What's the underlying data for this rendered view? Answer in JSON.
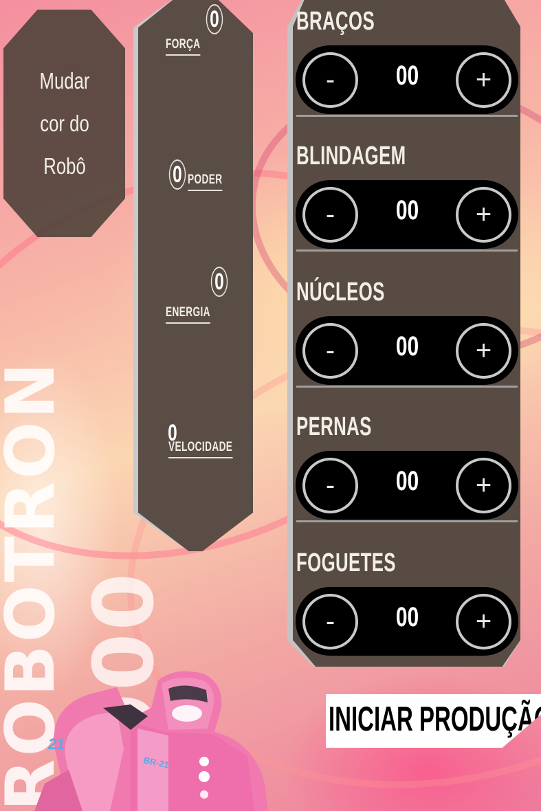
{
  "background_title": {
    "vertical_word": "ROBOTRON",
    "secondary_word": "2000"
  },
  "color_button": {
    "lines": [
      "Mudar",
      "cor do",
      "Robô"
    ]
  },
  "stats": [
    {
      "label": "FORÇA",
      "value": "0"
    },
    {
      "label": "PODER",
      "value": "0"
    },
    {
      "label": "ENERGIA",
      "value": "0"
    },
    {
      "label": "VELOCIDADE",
      "value": "0"
    }
  ],
  "parts": [
    {
      "name": "BRAÇOS",
      "value": "00",
      "minus": "-",
      "plus": "+"
    },
    {
      "name": "BLINDAGEM",
      "value": "00",
      "minus": "-",
      "plus": "+"
    },
    {
      "name": "NÚCLEOS",
      "value": "00",
      "minus": "-",
      "plus": "+"
    },
    {
      "name": "PERNAS",
      "value": "00",
      "minus": "-",
      "plus": "+"
    },
    {
      "name": "FOGUETES",
      "value": "00",
      "minus": "-",
      "plus": "+"
    }
  ],
  "start_button": {
    "label": "INICIAR PRODUÇÃO"
  },
  "robot": {
    "badge_number": "21",
    "chest_label": "BR-21"
  },
  "colors": {
    "panel": "#52443c",
    "accent_pink": "#f06b9c",
    "button_black": "#000000"
  }
}
